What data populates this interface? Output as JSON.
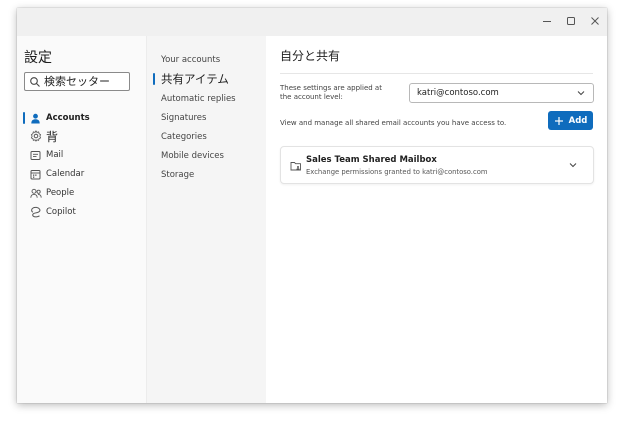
{
  "window": {
    "controls": {
      "minimize_icon": "minimize-icon",
      "maximize_icon": "maximize-icon",
      "close_icon": "close-icon"
    }
  },
  "sidebar": {
    "title": "設定",
    "search": {
      "placeholder": "検索セッター",
      "icon": "search-icon"
    },
    "items": [
      {
        "label": "Accounts",
        "icon": "person-icon",
        "selected": true
      },
      {
        "label": "背",
        "icon": "gear-icon",
        "selected": false
      },
      {
        "label": "Mail",
        "icon": "mail-icon",
        "selected": false
      },
      {
        "label": "Calendar",
        "icon": "calendar-icon",
        "selected": false
      },
      {
        "label": "People",
        "icon": "people-icon",
        "selected": false
      },
      {
        "label": "Copilot",
        "icon": "copilot-icon",
        "selected": false
      }
    ]
  },
  "subnav": {
    "items": [
      {
        "label": "Your accounts",
        "selected": false
      },
      {
        "label": "共有アイテム",
        "selected": true
      },
      {
        "label": "Automatic replies",
        "selected": false
      },
      {
        "label": "Signatures",
        "selected": false
      },
      {
        "label": "Categories",
        "selected": false
      },
      {
        "label": "Mobile devices",
        "selected": false
      },
      {
        "label": "Storage",
        "selected": false
      }
    ]
  },
  "main": {
    "title": "自分と共有",
    "applied_label": "These settings are applied at the account level:",
    "account_select": {
      "value": "katri@contoso.com",
      "icon": "chevron-down-icon"
    },
    "description": "View and manage all shared email accounts you have access to.",
    "add_button": {
      "label": "Add",
      "icon": "plus-icon"
    },
    "mailbox": {
      "name": "Sales Team Shared Mailbox",
      "subtitle": "Exchange permissions granted to katri@contoso.com",
      "icon": "shared-mailbox-icon",
      "expand_icon": "chevron-down-icon"
    }
  },
  "colors": {
    "accent": "#0f6cbd",
    "window_background": "#fafafa",
    "subnav_background": "#f5f5f5",
    "content_background": "#ffffff"
  }
}
